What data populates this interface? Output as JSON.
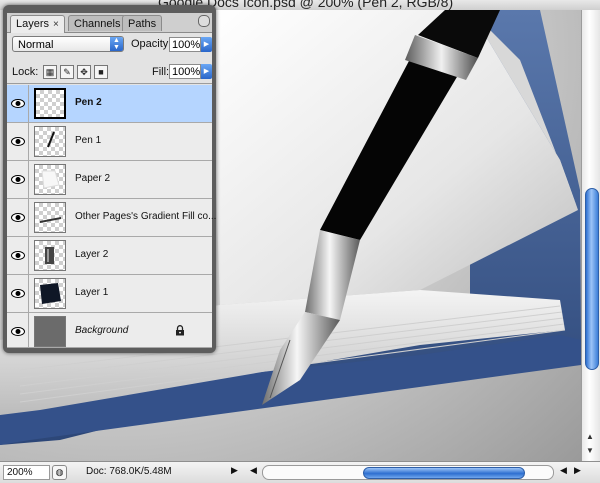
{
  "document": {
    "title": "Google Docs Icon.psd @ 200% (Pen 2, RGB/8)"
  },
  "layers_panel": {
    "tabs": [
      {
        "label": "Layers",
        "close": "×"
      },
      {
        "label": "Channels"
      },
      {
        "label": "Paths"
      }
    ],
    "blend_mode": "Normal",
    "opacity_label": "Opacity:",
    "opacity_value": "100%",
    "lock_label": "Lock:",
    "fill_label": "Fill:",
    "fill_value": "100%",
    "layers": [
      {
        "name": "Pen 2",
        "selected": true
      },
      {
        "name": "Pen 1"
      },
      {
        "name": "Paper 2"
      },
      {
        "name": "Other Pages's Gradient Fill co..."
      },
      {
        "name": "Layer 2"
      },
      {
        "name": "Layer 1"
      },
      {
        "name": "Background",
        "locked": true
      }
    ]
  },
  "status_bar": {
    "zoom": "200%",
    "doc_size": "Doc: 768.0K/5.48M"
  },
  "colors": {
    "selection_highlight": "#b5d5ff",
    "book_cover_blue": "#3b5c94",
    "scroll_thumb_blue": "#2d6fd0"
  }
}
